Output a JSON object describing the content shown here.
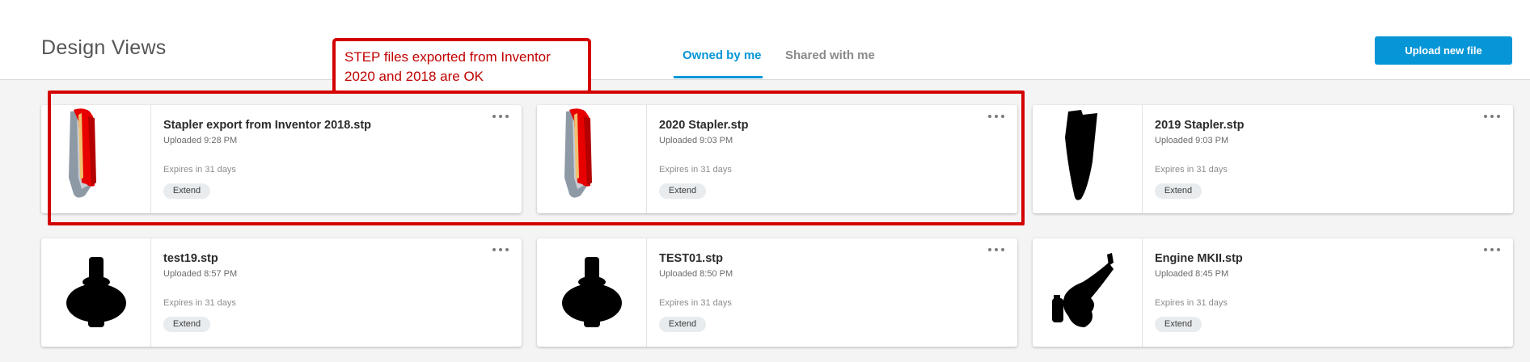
{
  "header": {
    "title": "Design Views",
    "tabs": [
      {
        "label": "Owned by me",
        "active": true
      },
      {
        "label": "Shared with me",
        "active": false
      }
    ],
    "upload_label": "Upload new file"
  },
  "annotation": {
    "text": "STEP files exported from Inventor 2020 and 2018 are OK",
    "color": "#d40000"
  },
  "colors": {
    "accent": "#0696d7",
    "highlight": "#d40000"
  },
  "files": [
    {
      "name": "Stapler export from Inventor 2018.stp",
      "uploaded": "Uploaded 9:28 PM",
      "expires": "Expires in 31 days",
      "action": "Extend",
      "thumbnail": "red-stapler-icon"
    },
    {
      "name": "2020 Stapler.stp",
      "uploaded": "Uploaded 9:03 PM",
      "expires": "Expires in 31 days",
      "action": "Extend",
      "thumbnail": "red-stapler-icon"
    },
    {
      "name": "2019 Stapler.stp",
      "uploaded": "Uploaded 9:03 PM",
      "expires": "Expires in 31 days",
      "action": "Extend",
      "thumbnail": "black-stapler-silhouette-icon"
    },
    {
      "name": "test19.stp",
      "uploaded": "Uploaded 8:57 PM",
      "expires": "Expires in 31 days",
      "action": "Extend",
      "thumbnail": "black-part-silhouette-icon"
    },
    {
      "name": "TEST01.stp",
      "uploaded": "Uploaded 8:50 PM",
      "expires": "Expires in 31 days",
      "action": "Extend",
      "thumbnail": "black-part-silhouette-icon"
    },
    {
      "name": "Engine MKII.stp",
      "uploaded": "Uploaded 8:45 PM",
      "expires": "Expires in 31 days",
      "action": "Extend",
      "thumbnail": "black-engine-silhouette-icon"
    }
  ]
}
